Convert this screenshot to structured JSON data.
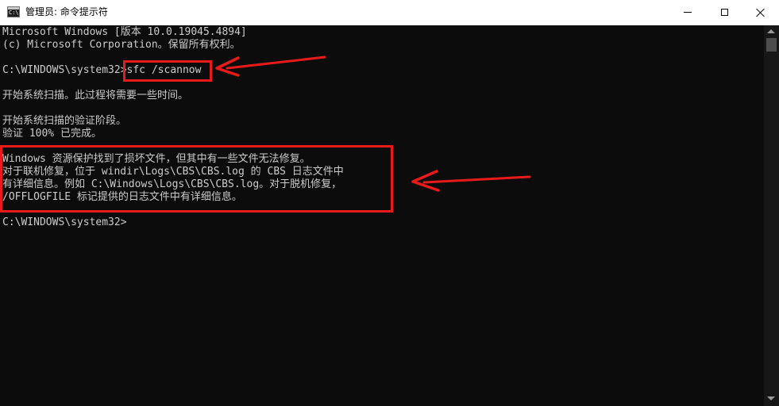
{
  "window": {
    "icon_label": "C:\\",
    "title": "管理员: 命令提示符"
  },
  "controls": {
    "minimize": "minimize",
    "maximize": "maximize",
    "close": "close"
  },
  "console": {
    "lines": [
      "Microsoft Windows [版本 10.0.19045.4894]",
      "(c) Microsoft Corporation。保留所有权利。",
      "",
      "C:\\WINDOWS\\system32>sfc /scannow",
      "",
      "开始系统扫描。此过程将需要一些时间。",
      "",
      "",
      "开始系统扫描的验证阶段。",
      "验证 100% 已完成。",
      "",
      "Windows 资源保护找到了损坏文件，但其中有一些文件无法修复。",
      "对于联机修复，位于 windir\\Logs\\CBS\\CBS.log 的 CBS 日志文件中",
      "有详细信息。例如 C:\\Windows\\Logs\\CBS\\CBS.log。对于脱机修复，",
      "/OFFLOGFILE 标记提供的日志文件中有详细信息。",
      "",
      "C:\\WINDOWS\\system32>"
    ]
  },
  "annotation_color": "#e81a1a"
}
